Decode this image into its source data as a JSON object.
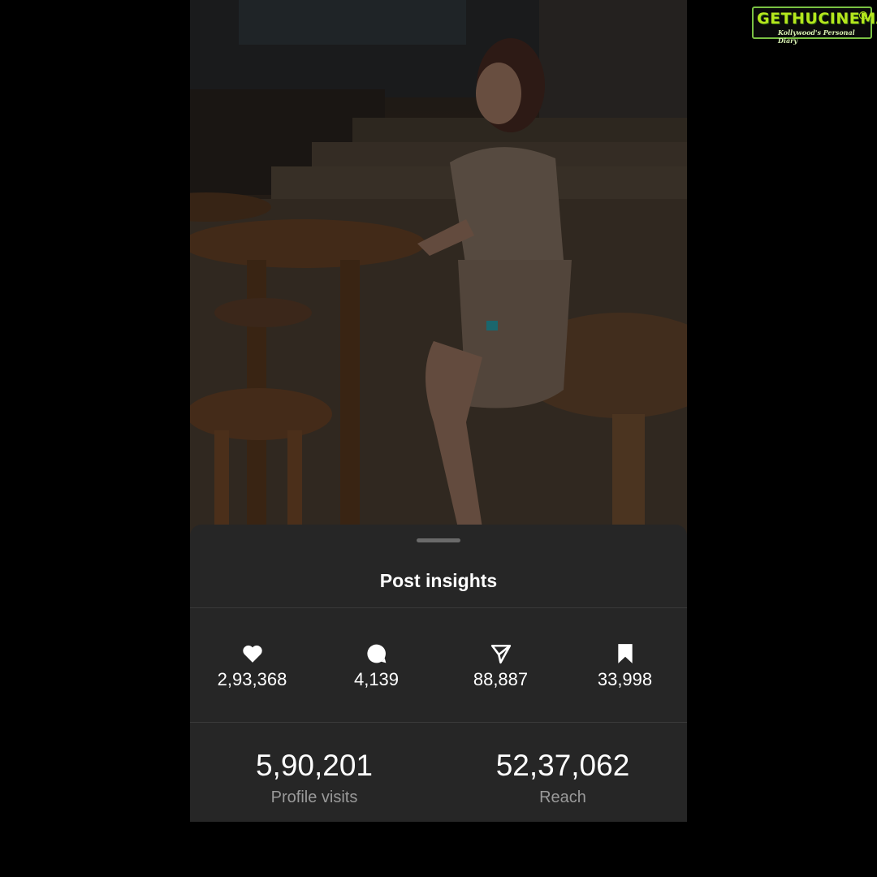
{
  "watermark": {
    "brand": "GETHUCINEMA",
    "tagline": "Kollywood's Personal Diary"
  },
  "sheet": {
    "title": "Post insights"
  },
  "stats": [
    {
      "icon": "heart-icon",
      "value": "2,93,368"
    },
    {
      "icon": "comment-icon",
      "value": "4,139"
    },
    {
      "icon": "send-icon",
      "value": "88,887"
    },
    {
      "icon": "bookmark-icon",
      "value": "33,998"
    }
  ],
  "summary": {
    "profile_visits": {
      "value": "5,90,201",
      "label": "Profile visits"
    },
    "reach": {
      "value": "52,37,062",
      "label": "Reach"
    }
  },
  "colors": {
    "background": "#000000",
    "sheet": "#262626",
    "text": "#ffffff",
    "muted": "#9a9a9a",
    "logo_green": "#b5e61d"
  }
}
